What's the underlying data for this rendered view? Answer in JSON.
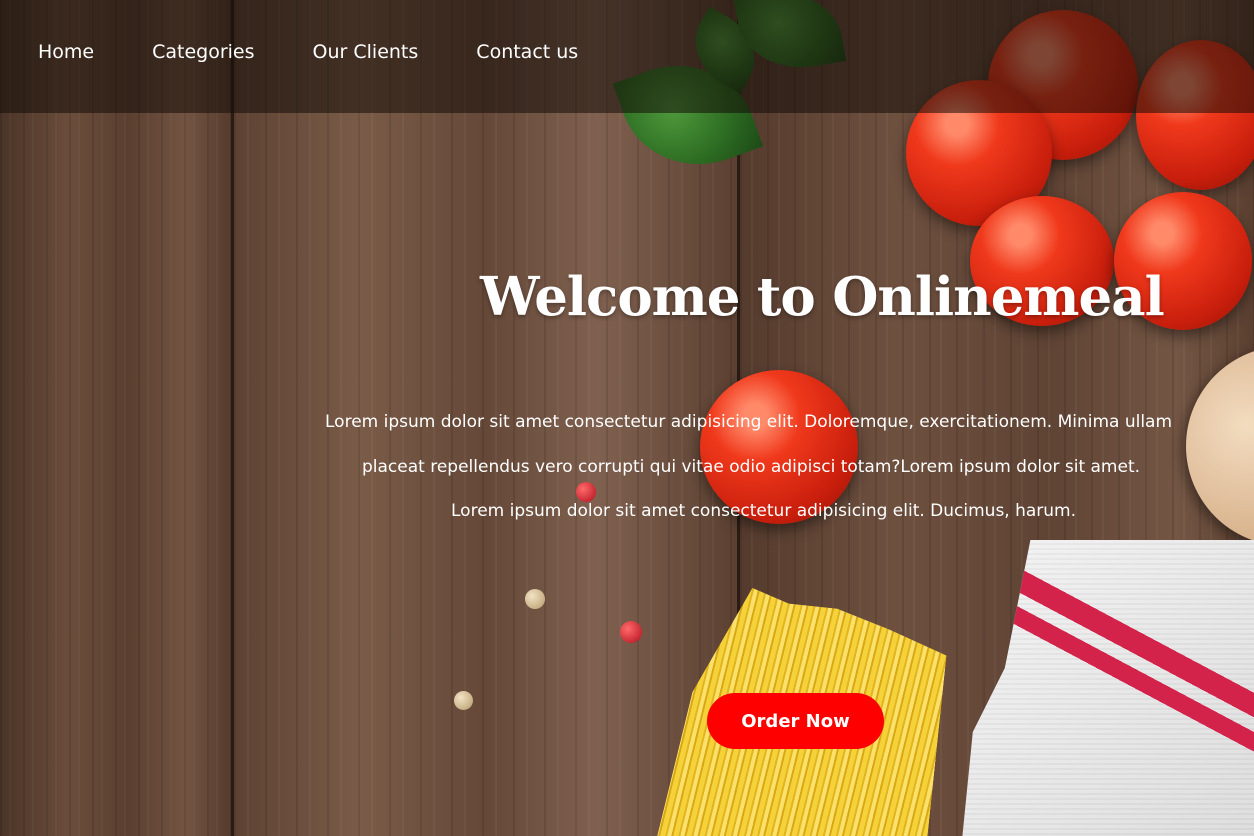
{
  "navbar": {
    "items": [
      {
        "label": "Home"
      },
      {
        "label": "Categories"
      },
      {
        "label": "Our Clients"
      },
      {
        "label": "Contact us"
      }
    ]
  },
  "hero": {
    "title": "Welcome to Onlinemeal",
    "paragraph_lines": [
      "Lorem ipsum dolor sit amet consectetur adipisicing elit. Doloremque, exercitationem. Minima ullam",
      "placeat repellendus vero corrupti qui vitae odio adipisci totam?Lorem ipsum dolor sit amet.",
      "Lorem ipsum dolor sit amet consectetur adipisicing elit. Ducimus, harum."
    ],
    "cta_label": "Order Now"
  },
  "colors": {
    "cta_background": "#ff0000",
    "nav_text": "#ffffff",
    "navbar_overlay": "rgba(20,12,8,0.55)"
  }
}
